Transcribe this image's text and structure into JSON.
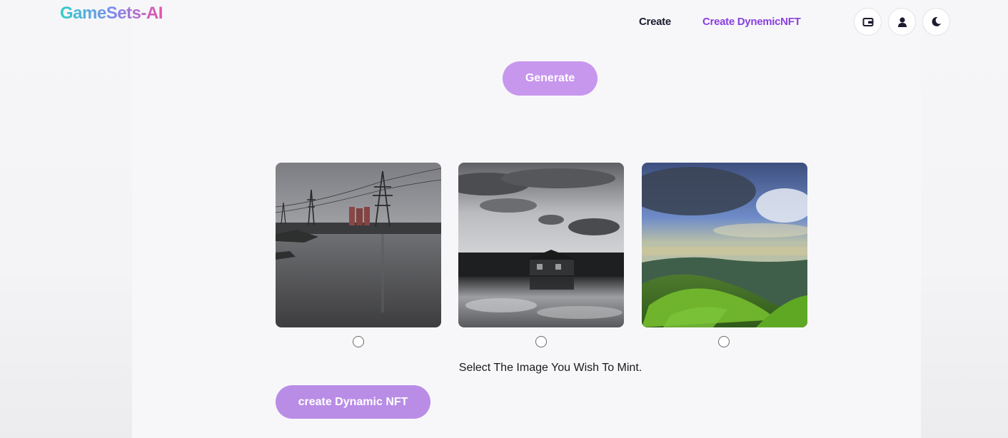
{
  "header": {
    "logo": "GameSets-AI",
    "nav": [
      {
        "label": "Create"
      },
      {
        "label": "Create DynemicNFT"
      }
    ],
    "icons": [
      "wallet-icon",
      "user-icon",
      "moon-icon"
    ]
  },
  "main": {
    "generate_label": "Generate",
    "images": [
      {
        "name": "flooded-power-towers"
      },
      {
        "name": "house-cloud-reflection"
      },
      {
        "name": "green-mountain-sky"
      }
    ],
    "instruction": "Select The Image You Wish To Mint.",
    "create_nft_label": "create Dynamic NFT"
  },
  "colors": {
    "accent": "#c797ee",
    "nav_active": "#8b3fe0",
    "nav_text": "#1b1b2f"
  }
}
